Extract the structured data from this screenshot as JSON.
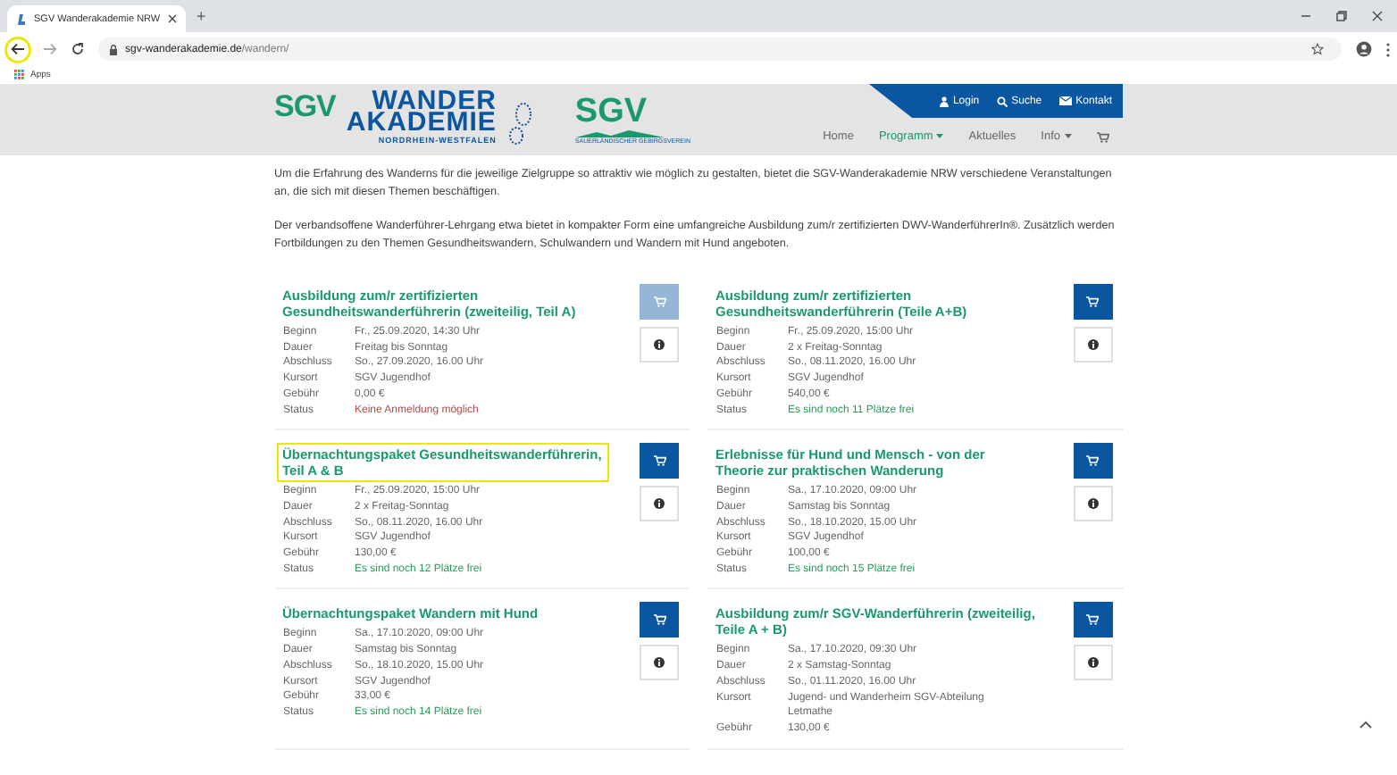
{
  "browser": {
    "tab_title": "SGV Wanderakademie NRW",
    "new_tab": "+",
    "url_host": "sgv-wanderakademie.de",
    "url_path": "/wandern/",
    "back_highlighted": true,
    "bookmarks": [
      "Apps"
    ]
  },
  "header": {
    "logo": {
      "brand": "SGV",
      "line1": "WANDER",
      "line2": "AKADEMIE",
      "line3": "NORDRHEIN-WESTFALEN",
      "partner": "SGV",
      "partner_sub": "SAUERLÄNDISCHER GEBIRGSVEREIN"
    },
    "top_links": [
      "Login",
      "Suche",
      "Kontakt"
    ],
    "nav": [
      {
        "label": "Home",
        "selected": false,
        "dropdown": false
      },
      {
        "label": "Programm",
        "selected": true,
        "dropdown": true
      },
      {
        "label": "Aktuelles",
        "selected": false,
        "dropdown": false
      },
      {
        "label": "Info",
        "selected": false,
        "dropdown": true
      }
    ]
  },
  "intro": [
    "Um die Erfahrung des Wanderns für die jeweilige Zielgruppe so attraktiv wie möglich zu gestalten, bietet die SGV-Wanderakademie NRW verschiedene Veranstaltungen an, die sich mit diesen Themen beschäftigen.",
    "Der verbandsoffene Wanderführer-Lehrgang etwa bietet in kompakter Form eine umfangreiche Ausbildung zum/r zertifizierten DWV-WanderführerIn®. Zusätzlich werden Fortbildungen zu den Themen Gesundheitswandern, Schulwandern und Wandern mit Hund angeboten."
  ],
  "courses": [
    {
      "title": "Ausbildung zum/r zertifizierten Gesundheitswanderführerin (zweiteilig, Teil A)",
      "highlighted": false,
      "cart_enabled": false,
      "rows": [
        {
          "label": "Beginn",
          "value": "Fr., 25.09.2020, 14:30 Uhr"
        },
        {
          "label": "Dauer",
          "value": "Freitag bis Sonntag"
        },
        {
          "label": "Abschluss",
          "value": "So., 27.09.2020, 16.00 Uhr"
        },
        {
          "label": "Kursort",
          "value": "SGV Jugendhof"
        },
        {
          "label": "Gebühr",
          "value": "0,00 €"
        },
        {
          "label": "Status",
          "value": "Keine Anmeldung möglich",
          "available": false
        }
      ]
    },
    {
      "title": "Ausbildung zum/r zertifizierten Gesundheitswanderführerin (Teile A+B)",
      "highlighted": false,
      "cart_enabled": true,
      "rows": [
        {
          "label": "Beginn",
          "value": "Fr., 25.09.2020, 15:00 Uhr"
        },
        {
          "label": "Dauer",
          "value": "2 x Freitag-Sonntag"
        },
        {
          "label": "Abschluss",
          "value": "So., 08.11.2020, 16.00 Uhr"
        },
        {
          "label": "Kursort",
          "value": "SGV Jugendhof"
        },
        {
          "label": "Gebühr",
          "value": "540,00 €"
        },
        {
          "label": "Status",
          "value": "Es sind noch 11 Plätze frei",
          "available": true
        }
      ]
    },
    {
      "title": "Übernachtungspaket Gesundheitswanderführerin, Teil A & B",
      "highlighted": true,
      "cart_enabled": true,
      "rows": [
        {
          "label": "Beginn",
          "value": "Fr., 25.09.2020, 15:00 Uhr"
        },
        {
          "label": "Dauer",
          "value": "2 x Freitag-Sonntag"
        },
        {
          "label": "Abschluss",
          "value": "So., 08.11.2020, 16.00 Uhr"
        },
        {
          "label": "Kursort",
          "value": "SGV Jugendhof"
        },
        {
          "label": "Gebühr",
          "value": "130,00 €"
        },
        {
          "label": "Status",
          "value": "Es sind noch 12 Plätze frei",
          "available": true
        }
      ]
    },
    {
      "title": "Erlebnisse für Hund und Mensch - von der Theorie zur praktischen Wanderung",
      "highlighted": false,
      "cart_enabled": true,
      "rows": [
        {
          "label": "Beginn",
          "value": "Sa., 17.10.2020, 09:00 Uhr"
        },
        {
          "label": "Dauer",
          "value": "Samstag bis Sonntag"
        },
        {
          "label": "Abschluss",
          "value": "So., 18.10.2020, 15.00 Uhr"
        },
        {
          "label": "Kursort",
          "value": "SGV Jugendhof"
        },
        {
          "label": "Gebühr",
          "value": "100,00 €"
        },
        {
          "label": "Status",
          "value": "Es sind noch 15 Plätze frei",
          "available": true
        }
      ]
    },
    {
      "title": "Übernachtungspaket Wandern mit Hund",
      "highlighted": false,
      "cart_enabled": true,
      "rows": [
        {
          "label": "Beginn",
          "value": "Sa., 17.10.2020, 09:00 Uhr"
        },
        {
          "label": "Dauer",
          "value": "Samstag bis Sonntag"
        },
        {
          "label": "Abschluss",
          "value": "So., 18.10.2020, 15.00 Uhr"
        },
        {
          "label": "Kursort",
          "value": "SGV Jugendhof"
        },
        {
          "label": "Gebühr",
          "value": "33,00 €"
        },
        {
          "label": "Status",
          "value": "Es sind noch 14 Plätze frei",
          "available": true
        }
      ]
    },
    {
      "title": "Ausbildung zum/r SGV-Wanderführerin (zweiteilig, Teile A + B)",
      "highlighted": false,
      "cart_enabled": true,
      "rows": [
        {
          "label": "Beginn",
          "value": "Sa., 17.10.2020, 09:30 Uhr"
        },
        {
          "label": "Dauer",
          "value": "2 x Samstag-Sonntag"
        },
        {
          "label": "Abschluss",
          "value": "So., 01.11.2020, 16.00 Uhr"
        },
        {
          "label": "Kursort",
          "value": "Jugend- und Wanderheim SGV-Abteilung Letmathe"
        },
        {
          "label": "Gebühr",
          "value": "130,00 €"
        }
      ]
    }
  ]
}
